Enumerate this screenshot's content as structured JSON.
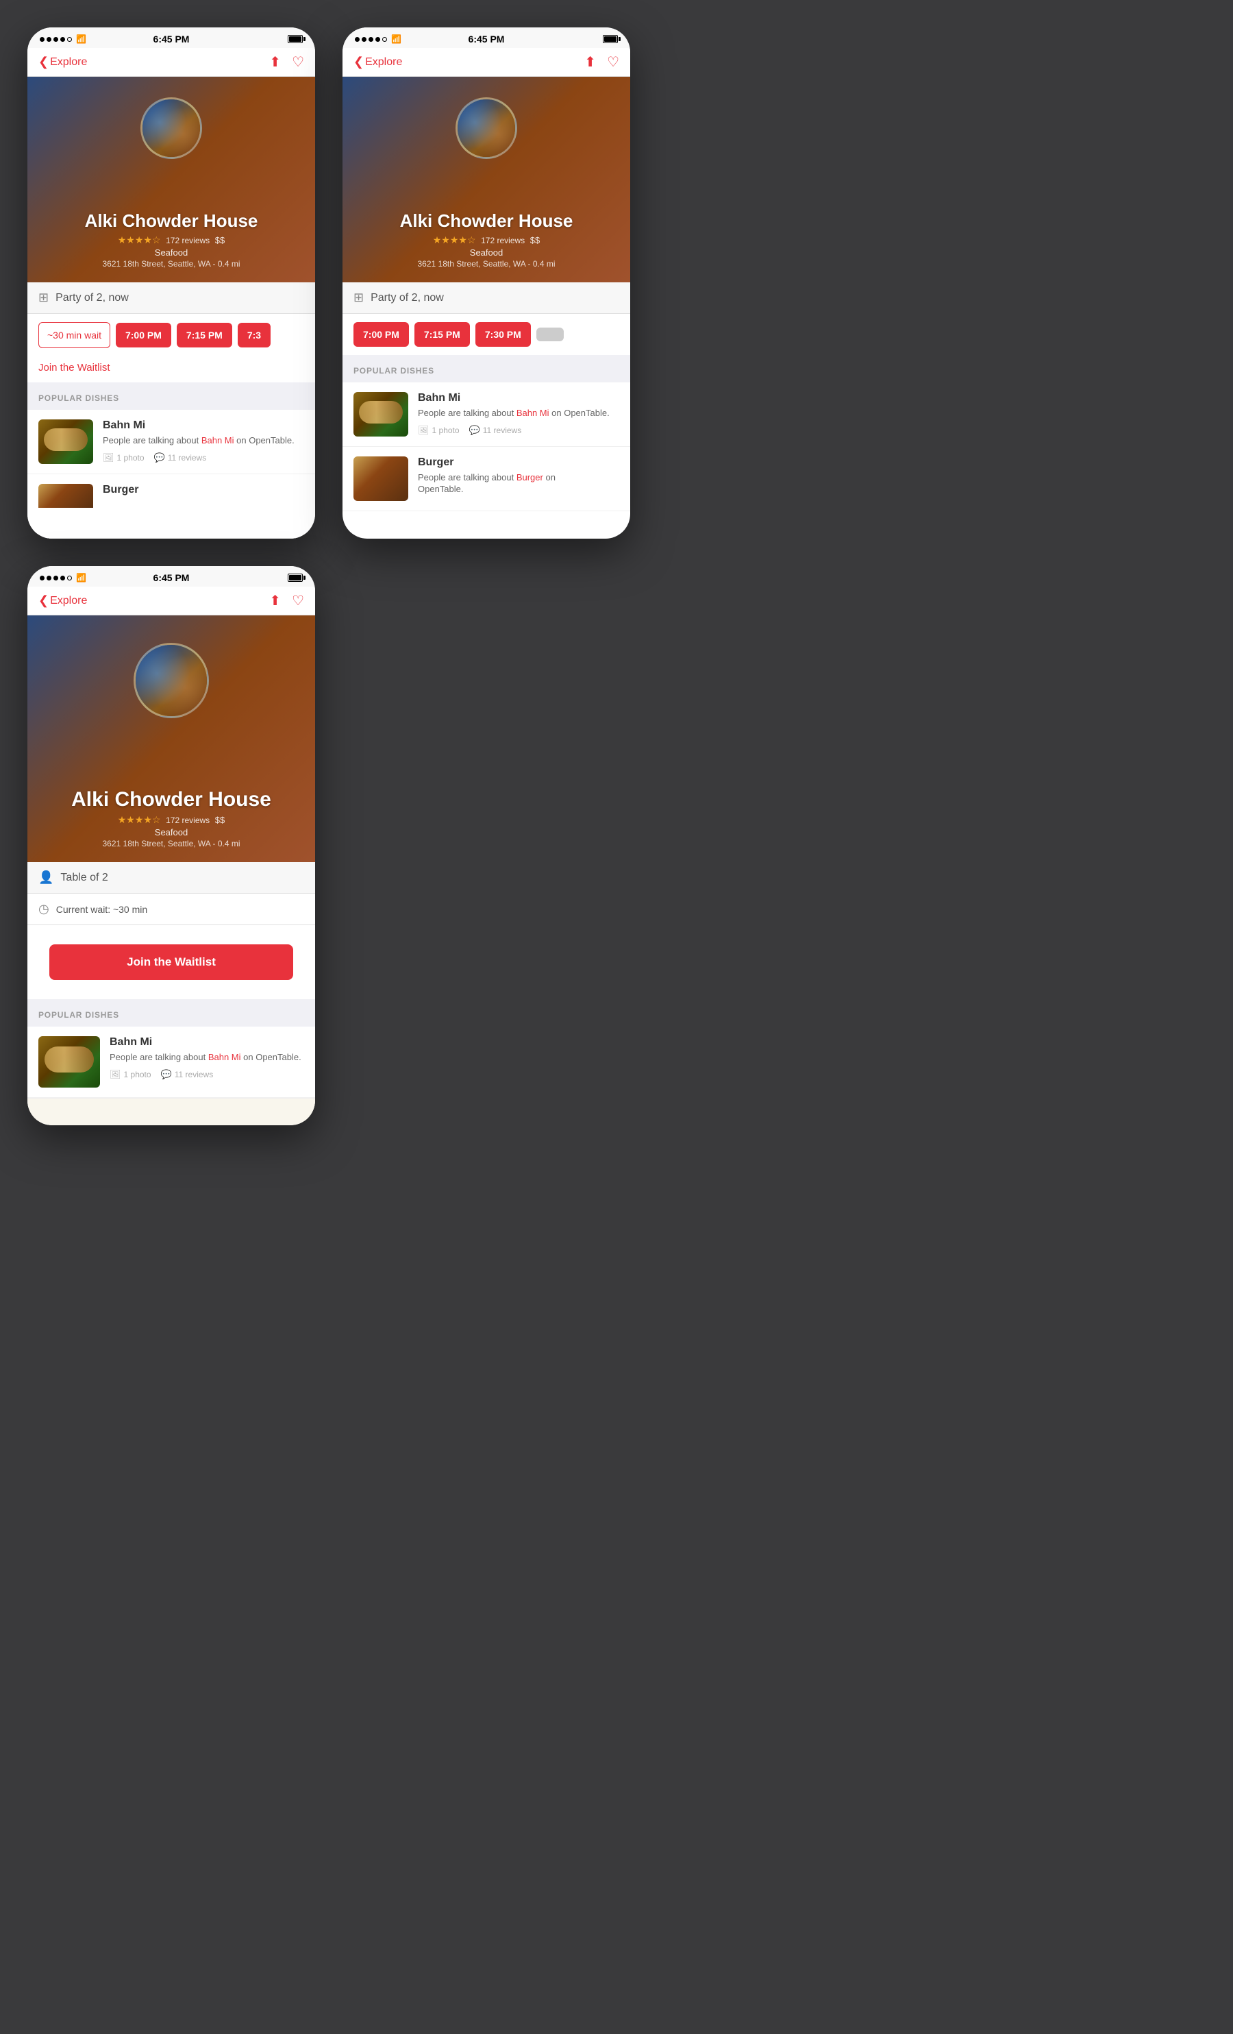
{
  "app": {
    "statusBar": {
      "time": "6:45 PM",
      "back": "Explore"
    },
    "restaurant": {
      "name": "Alki Chowder House",
      "stars": "★★★★☆",
      "reviews": "172 reviews",
      "price": "$$",
      "category": "Seafood",
      "address": "3621 18th Street, Seattle, WA - 0.4 mi"
    }
  },
  "phone1": {
    "party": "Party of 2, now",
    "waitBtn": "~30 min wait",
    "times": [
      "7:00 PM",
      "7:15 PM"
    ],
    "timeTruncated": "7:3",
    "waitlistLink": "Join the Waitlist",
    "popularDishes": {
      "header": "POPULAR DISHES",
      "items": [
        {
          "name": "Bahn Mi",
          "desc1": "People are talking about ",
          "link": "Bahn Mi",
          "desc2": " on OpenTable.",
          "photos": "1 photo",
          "reviews": "11 reviews"
        },
        {
          "name": "Burger",
          "desc1": "",
          "link": "",
          "desc2": "",
          "photos": "",
          "reviews": ""
        }
      ]
    }
  },
  "phone2": {
    "party": "Party of 2, now",
    "times": [
      "7:00 PM",
      "7:15 PM",
      "7:30 PM"
    ],
    "popularDishes": {
      "header": "POPULAR DISHES",
      "items": [
        {
          "name": "Bahn Mi",
          "desc1": "People are talking about ",
          "link": "Bahn Mi",
          "desc2": " on OpenTable.",
          "photos": "1 photo",
          "reviews": "11 reviews"
        },
        {
          "name": "Burger",
          "desc1": "People are talking about ",
          "link": "Burger",
          "desc2": " on OpenTable.",
          "photos": "",
          "reviews": ""
        }
      ]
    }
  },
  "phone3": {
    "tableOf": "Table of 2",
    "currentWait": "Current wait: ~30 min",
    "waitlistBtn": "Join the Waitlist",
    "popularDishes": {
      "header": "POPULAR DISHES",
      "items": [
        {
          "name": "Bahn Mi",
          "desc1": "People are talking about ",
          "link": "Bahn Mi",
          "desc2": " on OpenTable.",
          "photos": "1 photo",
          "reviews": "11 reviews"
        }
      ]
    }
  },
  "icons": {
    "back": "❮",
    "share": "⬆",
    "heart": "♡",
    "table": "⊞",
    "person": "👤",
    "clock": "◷",
    "photo": "🖼",
    "comment": "💬"
  }
}
